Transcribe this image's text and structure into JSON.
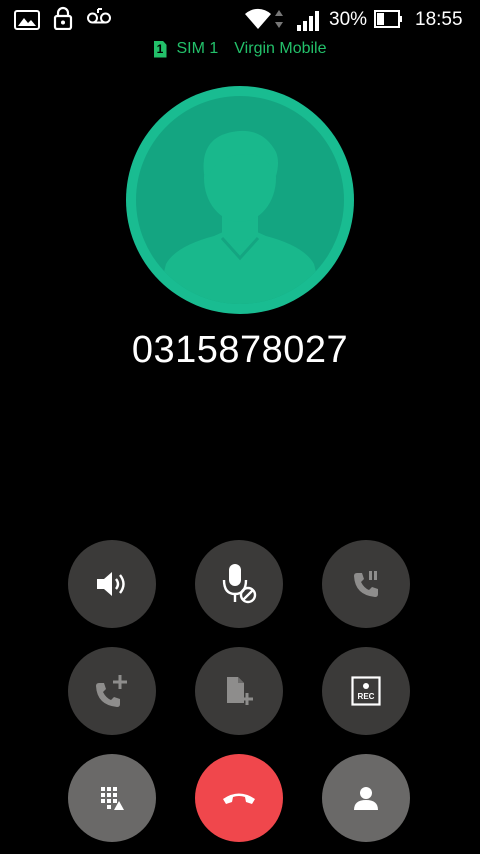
{
  "status_bar": {
    "battery_percent": "30%",
    "time": "18:55",
    "icons": [
      "gallery-icon",
      "lock-icon",
      "voicemail-icon",
      "wifi-icon",
      "signal-icon",
      "battery-icon"
    ]
  },
  "sim": {
    "badge_number": "1",
    "label": "SIM 1",
    "carrier": "Virgin Mobile",
    "color": "#23c06a"
  },
  "call": {
    "number": "0315878027",
    "avatar_color": "#19bc91"
  },
  "controls": [
    {
      "name": "speaker-button",
      "icon": "speaker-icon"
    },
    {
      "name": "mute-button",
      "icon": "mic-muted-icon"
    },
    {
      "name": "hold-button",
      "icon": "phone-hold-icon"
    },
    {
      "name": "add-call-button",
      "icon": "add-call-icon"
    },
    {
      "name": "add-note-button",
      "icon": "note-add-icon"
    },
    {
      "name": "record-button",
      "icon": "record-icon",
      "label": "REC"
    },
    {
      "name": "keypad-button",
      "icon": "dialpad-icon"
    },
    {
      "name": "end-call-button",
      "icon": "end-call-icon",
      "color": "#f0474c"
    },
    {
      "name": "contacts-button",
      "icon": "contact-icon"
    }
  ]
}
